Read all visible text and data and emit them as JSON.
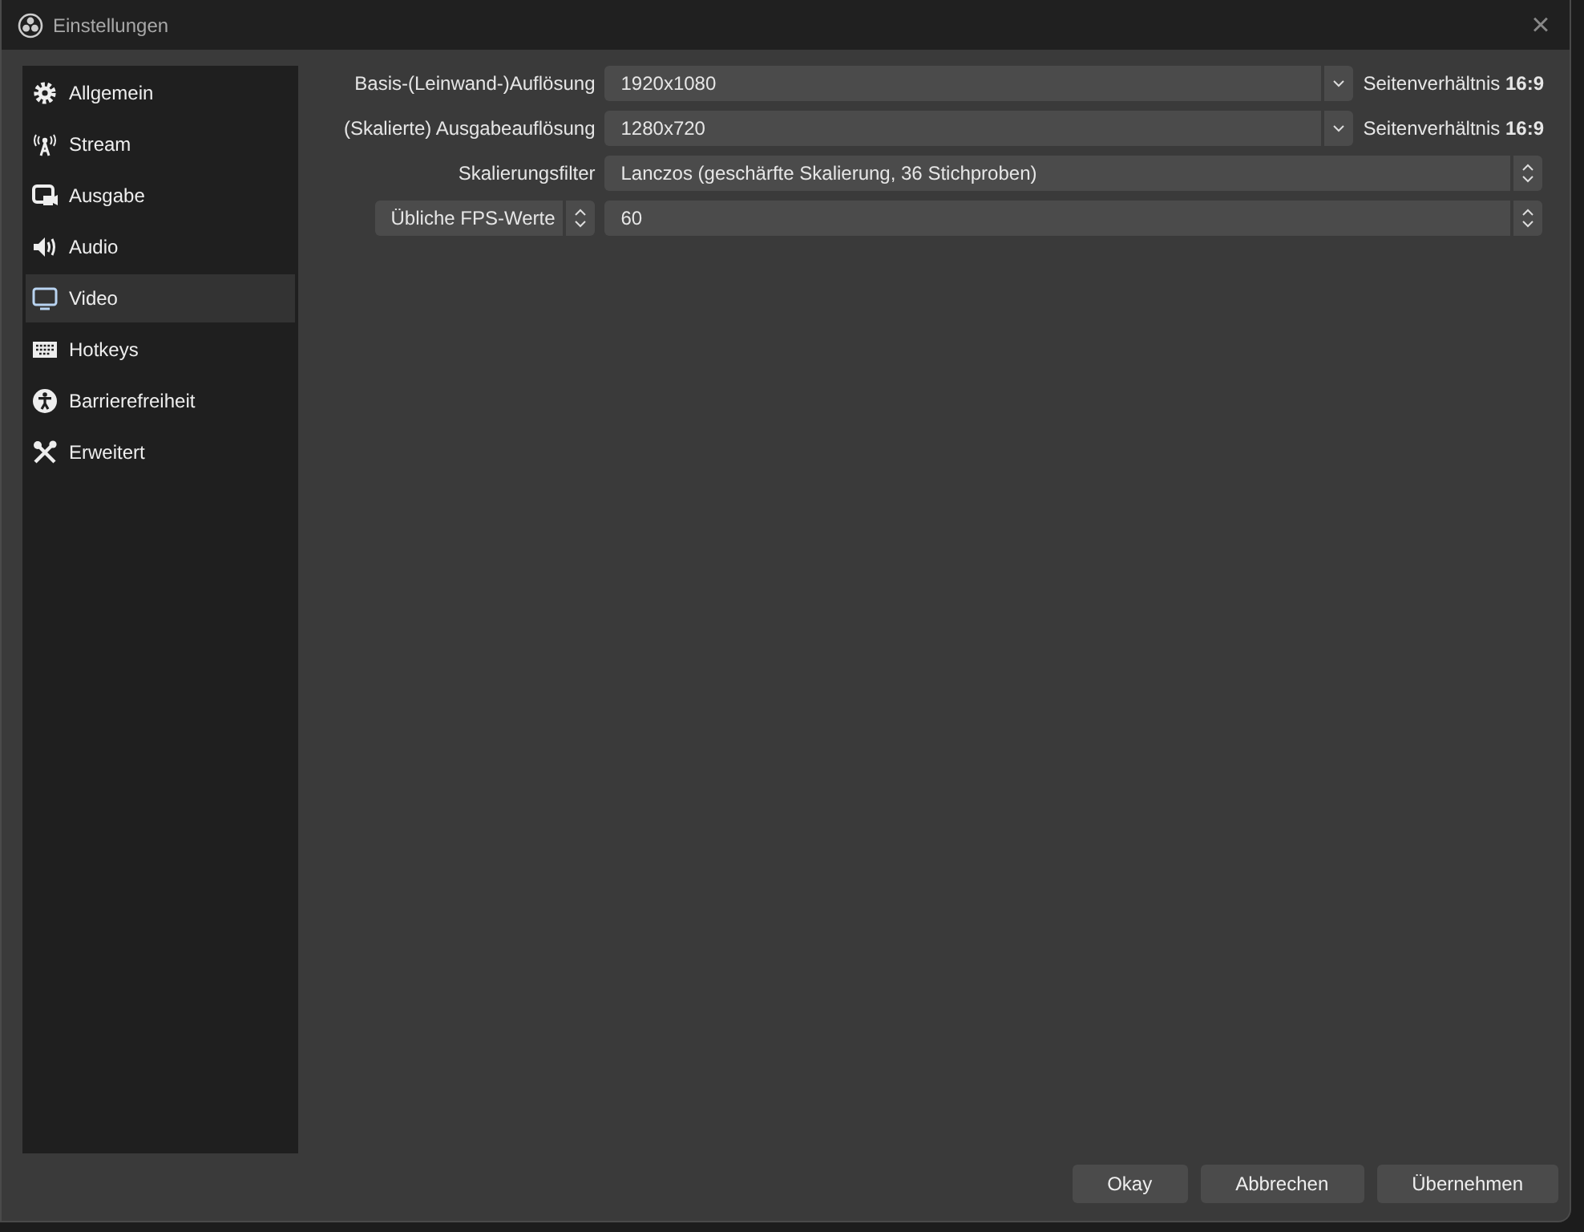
{
  "window": {
    "title": "Einstellungen",
    "close": "×"
  },
  "sidebar": {
    "items": [
      {
        "label": "Allgemein",
        "selected": false
      },
      {
        "label": "Stream",
        "selected": false
      },
      {
        "label": "Ausgabe",
        "selected": false
      },
      {
        "label": "Audio",
        "selected": false
      },
      {
        "label": "Video",
        "selected": true
      },
      {
        "label": "Hotkeys",
        "selected": false
      },
      {
        "label": "Barrierefreiheit",
        "selected": false
      },
      {
        "label": "Erweitert",
        "selected": false
      }
    ]
  },
  "settings": [
    {
      "kind": "dropdown",
      "label": "Basis-(Leinwand-)Auflösung",
      "value": "1920x1080",
      "aspect": "Seitenverhältnis **16:9**"
    },
    {
      "kind": "dropdown",
      "label": "(Skalierte) Ausgabeauflösung",
      "value": "1280x720",
      "aspect": "Seitenverhältnis **16:9**"
    },
    {
      "kind": "select",
      "label": "Skalierungsfilter",
      "value": "Lanczos (geschärfte Skalierung, 36 Stichproben)"
    },
    {
      "kind": "select-mode",
      "label": "Übliche FPS-Werte",
      "value": "60"
    }
  ],
  "buttons": [
    "Okay",
    "Abbrechen",
    "Übernehmen"
  ]
}
